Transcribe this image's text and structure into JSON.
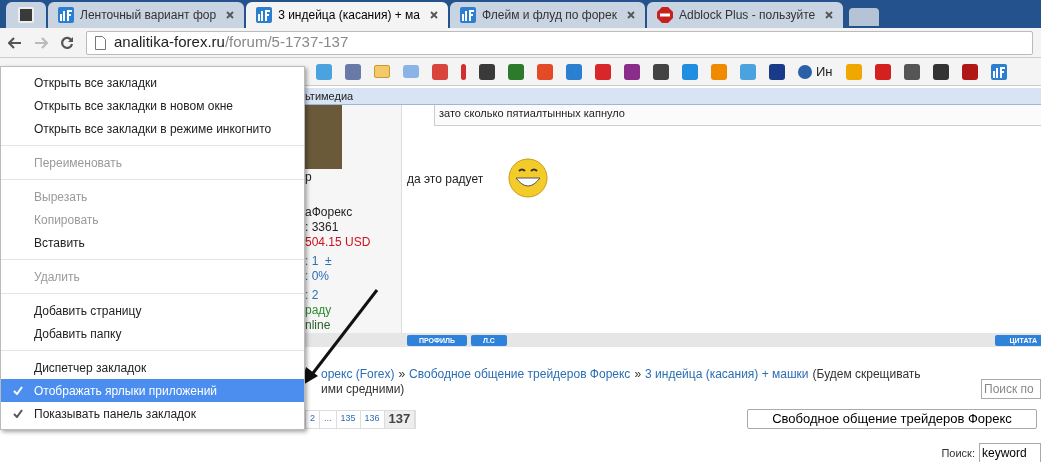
{
  "tabs": [
    {
      "kind": "forex",
      "title": "Ленточный вариант фор",
      "selected": false
    },
    {
      "kind": "forex",
      "title": "3 индейца (касания) + ма",
      "selected": true
    },
    {
      "kind": "forex",
      "title": "Флейм и флуд по форек",
      "selected": false
    },
    {
      "kind": "adblock",
      "title": "Adblock Plus - пользуйте",
      "selected": false
    }
  ],
  "address": {
    "host": "analitika-forex.ru",
    "path": "/forum/5-1737-137"
  },
  "bookmarks_bar": {
    "label": "Ин"
  },
  "menu": [
    {
      "kind": "item",
      "label": "Открыть все закладки",
      "disabled": false,
      "checked": false,
      "selected": false
    },
    {
      "kind": "item",
      "label": "Открыть все закладки в новом окне",
      "disabled": false,
      "checked": false,
      "selected": false
    },
    {
      "kind": "item",
      "label": "Открыть все закладки в режиме инкогнито",
      "disabled": false,
      "checked": false,
      "selected": false
    },
    {
      "kind": "separator"
    },
    {
      "kind": "item",
      "label": "Переименовать",
      "disabled": true,
      "checked": false,
      "selected": false
    },
    {
      "kind": "separator"
    },
    {
      "kind": "item",
      "label": "Вырезать",
      "disabled": true,
      "checked": false,
      "selected": false
    },
    {
      "kind": "item",
      "label": "Копировать",
      "disabled": true,
      "checked": false,
      "selected": false
    },
    {
      "kind": "item",
      "label": "Вставить",
      "disabled": false,
      "checked": false,
      "selected": false
    },
    {
      "kind": "separator"
    },
    {
      "kind": "item",
      "label": "Удалить",
      "disabled": true,
      "checked": false,
      "selected": false
    },
    {
      "kind": "separator"
    },
    {
      "kind": "item",
      "label": "Добавить страницу",
      "disabled": false,
      "checked": false,
      "selected": false
    },
    {
      "kind": "item",
      "label": "Добавить папку",
      "disabled": false,
      "checked": false,
      "selected": false
    },
    {
      "kind": "separator"
    },
    {
      "kind": "item",
      "label": "Диспетчер закладок",
      "disabled": false,
      "checked": false,
      "selected": false
    },
    {
      "kind": "item",
      "label": "Отображать ярлыки приложений",
      "disabled": false,
      "checked": true,
      "selected": true
    },
    {
      "kind": "item",
      "label": "Показывать панель закладок",
      "disabled": false,
      "checked": true,
      "selected": false
    }
  ],
  "forum": {
    "section_bar": "ьтимедиа",
    "author_lines": [
      {
        "kind": "plain",
        "text": "р"
      },
      {
        "kind": "plain",
        "text": "аФорекс"
      },
      {
        "kind": "plain",
        "text": ": 3361"
      },
      {
        "kind": "money",
        "text": "504.15 USD"
      },
      {
        "kind": "link",
        "text": ": 1  ±"
      },
      {
        "kind": "link",
        "text": ": 0%"
      },
      {
        "kind": "link",
        "text": ": 2"
      },
      {
        "kind": "award",
        "text": "раду"
      },
      {
        "kind": "online",
        "text": "nline"
      }
    ],
    "quote": "зато сколько пятиалтынных капнуло",
    "message": "да это радует",
    "post_buttons": [
      "ПРОФИЛЬ",
      "Л.С"
    ],
    "quote_button": "ЦИТАТА",
    "breadcrumb": {
      "links": [
        "орекс (Forex)",
        "Свободное общение трейдеров Форекс",
        "3 индейца (касания) + машки"
      ],
      "separator": "»",
      "tail": "(Будем скрещивать",
      "tail_line2": "ими средними)"
    },
    "search_box": {
      "placeholder": "Поиск по"
    },
    "pages": [
      {
        "label": "2",
        "selected": false
      },
      {
        "label": "...",
        "selected": false
      },
      {
        "label": "135",
        "selected": false
      },
      {
        "label": "136",
        "selected": false
      },
      {
        "label": "137",
        "selected": true
      }
    ],
    "forum_select": "Свободное общение трейдеров Форекс",
    "search": {
      "label": "Поиск:",
      "value": "keyword"
    }
  }
}
